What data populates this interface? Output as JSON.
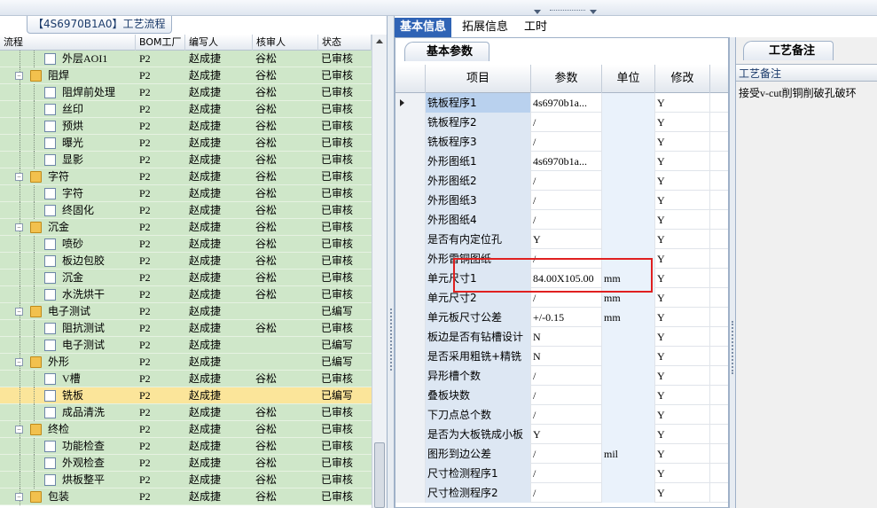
{
  "left_panel": {
    "title": "【4S6970B1A0】工艺流程",
    "headers": [
      "流程",
      "BOM工厂",
      "编写人",
      "核审人",
      "状态"
    ],
    "rows": [
      {
        "name": "外层AOI1",
        "level": 1,
        "type": "doc",
        "bom": "P2",
        "writer": "赵成捷",
        "reviewer": "谷松",
        "status": "已审核"
      },
      {
        "name": "阻焊",
        "level": 0,
        "type": "folder",
        "bom": "P2",
        "writer": "赵成捷",
        "reviewer": "谷松",
        "status": "已审核"
      },
      {
        "name": "阻焊前处理",
        "level": 1,
        "type": "doc",
        "bom": "P2",
        "writer": "赵成捷",
        "reviewer": "谷松",
        "status": "已审核"
      },
      {
        "name": "丝印",
        "level": 1,
        "type": "doc",
        "bom": "P2",
        "writer": "赵成捷",
        "reviewer": "谷松",
        "status": "已审核"
      },
      {
        "name": "预烘",
        "level": 1,
        "type": "doc",
        "bom": "P2",
        "writer": "赵成捷",
        "reviewer": "谷松",
        "status": "已审核"
      },
      {
        "name": "曝光",
        "level": 1,
        "type": "doc",
        "bom": "P2",
        "writer": "赵成捷",
        "reviewer": "谷松",
        "status": "已审核"
      },
      {
        "name": "显影",
        "level": 1,
        "type": "doc",
        "bom": "P2",
        "writer": "赵成捷",
        "reviewer": "谷松",
        "status": "已审核"
      },
      {
        "name": "字符",
        "level": 0,
        "type": "folder",
        "bom": "P2",
        "writer": "赵成捷",
        "reviewer": "谷松",
        "status": "已审核"
      },
      {
        "name": "字符",
        "level": 1,
        "type": "doc",
        "bom": "P2",
        "writer": "赵成捷",
        "reviewer": "谷松",
        "status": "已审核"
      },
      {
        "name": "终固化",
        "level": 1,
        "type": "doc",
        "bom": "P2",
        "writer": "赵成捷",
        "reviewer": "谷松",
        "status": "已审核"
      },
      {
        "name": "沉金",
        "level": 0,
        "type": "folder",
        "bom": "P2",
        "writer": "赵成捷",
        "reviewer": "谷松",
        "status": "已审核"
      },
      {
        "name": "喷砂",
        "level": 1,
        "type": "doc",
        "bom": "P2",
        "writer": "赵成捷",
        "reviewer": "谷松",
        "status": "已审核"
      },
      {
        "name": "板边包胶",
        "level": 1,
        "type": "doc",
        "bom": "P2",
        "writer": "赵成捷",
        "reviewer": "谷松",
        "status": "已审核"
      },
      {
        "name": "沉金",
        "level": 1,
        "type": "doc",
        "bom": "P2",
        "writer": "赵成捷",
        "reviewer": "谷松",
        "status": "已审核"
      },
      {
        "name": "水洗烘干",
        "level": 1,
        "type": "doc",
        "bom": "P2",
        "writer": "赵成捷",
        "reviewer": "谷松",
        "status": "已审核"
      },
      {
        "name": "电子测试",
        "level": 0,
        "type": "folder",
        "bom": "P2",
        "writer": "赵成捷",
        "reviewer": "",
        "status": "已编写"
      },
      {
        "name": "阻抗测试",
        "level": 1,
        "type": "doc",
        "bom": "P2",
        "writer": "赵成捷",
        "reviewer": "谷松",
        "status": "已审核"
      },
      {
        "name": "电子测试",
        "level": 1,
        "type": "doc",
        "bom": "P2",
        "writer": "赵成捷",
        "reviewer": "",
        "status": "已编写"
      },
      {
        "name": "外形",
        "level": 0,
        "type": "folder",
        "bom": "P2",
        "writer": "赵成捷",
        "reviewer": "",
        "status": "已编写"
      },
      {
        "name": "V槽",
        "level": 1,
        "type": "doc",
        "bom": "P2",
        "writer": "赵成捷",
        "reviewer": "谷松",
        "status": "已审核"
      },
      {
        "name": "铣板",
        "level": 1,
        "type": "doc",
        "bom": "P2",
        "writer": "赵成捷",
        "reviewer": "",
        "status": "已编写",
        "selected": true
      },
      {
        "name": "成品清洗",
        "level": 1,
        "type": "doc",
        "bom": "P2",
        "writer": "赵成捷",
        "reviewer": "谷松",
        "status": "已审核"
      },
      {
        "name": "终检",
        "level": 0,
        "type": "folder",
        "bom": "P2",
        "writer": "赵成捷",
        "reviewer": "谷松",
        "status": "已审核"
      },
      {
        "name": "功能检查",
        "level": 1,
        "type": "doc",
        "bom": "P2",
        "writer": "赵成捷",
        "reviewer": "谷松",
        "status": "已审核"
      },
      {
        "name": "外观检查",
        "level": 1,
        "type": "doc",
        "bom": "P2",
        "writer": "赵成捷",
        "reviewer": "谷松",
        "status": "已审核"
      },
      {
        "name": "烘板整平",
        "level": 1,
        "type": "doc",
        "bom": "P2",
        "writer": "赵成捷",
        "reviewer": "谷松",
        "status": "已审核"
      },
      {
        "name": "包装",
        "level": 0,
        "type": "folder",
        "bom": "P2",
        "writer": "赵成捷",
        "reviewer": "谷松",
        "status": "已审核"
      }
    ]
  },
  "tabs": [
    "基本信息",
    "拓展信息",
    "工时"
  ],
  "mid_panel": {
    "subtab": "基本参数",
    "headers": [
      "项目",
      "参数",
      "单位",
      "修改"
    ],
    "rows": [
      {
        "item": "铣板程序1",
        "param": "4s6970b1a...",
        "unit": "",
        "mod": "Y"
      },
      {
        "item": "铣板程序2",
        "param": "/",
        "unit": "",
        "mod": "Y"
      },
      {
        "item": "铣板程序3",
        "param": "/",
        "unit": "",
        "mod": "Y"
      },
      {
        "item": "外形图纸1",
        "param": "4s6970b1a...",
        "unit": "",
        "mod": "Y"
      },
      {
        "item": "外形图纸2",
        "param": "/",
        "unit": "",
        "mod": "Y"
      },
      {
        "item": "外形图纸3",
        "param": "/",
        "unit": "",
        "mod": "Y"
      },
      {
        "item": "外形图纸4",
        "param": "/",
        "unit": "",
        "mod": "Y"
      },
      {
        "item": "是否有内定位孔",
        "param": "Y",
        "unit": "",
        "mod": "Y"
      },
      {
        "item": "外形雷铜图纸",
        "param": "/",
        "unit": "",
        "mod": "Y"
      },
      {
        "item": "单元尺寸1",
        "param": "84.00X105.00",
        "unit": "mm",
        "mod": "Y"
      },
      {
        "item": "单元尺寸2",
        "param": "/",
        "unit": "mm",
        "mod": "Y"
      },
      {
        "item": "单元板尺寸公差",
        "param": "+/-0.15",
        "unit": "mm",
        "mod": "Y"
      },
      {
        "item": "板边是否有钻槽设计",
        "param": "N",
        "unit": "",
        "mod": "Y"
      },
      {
        "item": "是否采用粗铣+精铣",
        "param": "N",
        "unit": "",
        "mod": "Y"
      },
      {
        "item": "异形槽个数",
        "param": "/",
        "unit": "",
        "mod": "Y"
      },
      {
        "item": "叠板块数",
        "param": "/",
        "unit": "",
        "mod": "Y"
      },
      {
        "item": "下刀点总个数",
        "param": "/",
        "unit": "",
        "mod": "Y"
      },
      {
        "item": "是否为大板铣成小板",
        "param": "Y",
        "unit": "",
        "mod": "Y"
      },
      {
        "item": "图形到边公差",
        "param": "/",
        "unit": "mil",
        "mod": "Y"
      },
      {
        "item": "尺寸检测程序1",
        "param": "/",
        "unit": "",
        "mod": "Y"
      },
      {
        "item": "尺寸检测程序2",
        "param": "/",
        "unit": "",
        "mod": "Y"
      }
    ]
  },
  "right_panel": {
    "tab": "工艺备注",
    "label": "工艺备注",
    "text": "接受v-cut削铜削破孔破环"
  }
}
